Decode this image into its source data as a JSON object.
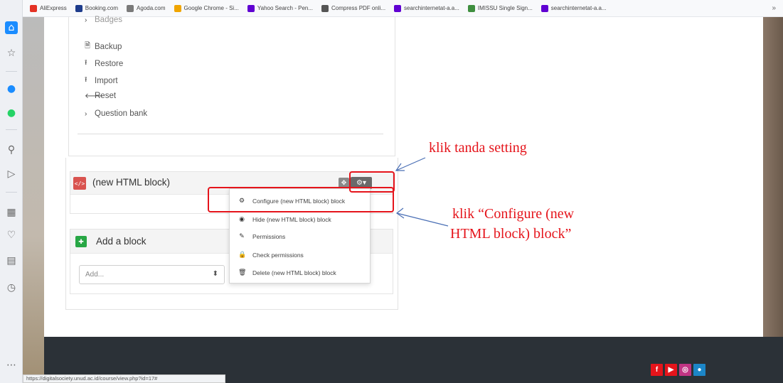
{
  "bookmarks": [
    {
      "label": "AliExpress",
      "color": "#e43225"
    },
    {
      "label": "Booking.com",
      "color": "#1e3c8c"
    },
    {
      "label": "Agoda.com",
      "color": "#7a7a7a"
    },
    {
      "label": "Google Chrome - Si...",
      "color": "#f0a500"
    },
    {
      "label": "Yahoo Search - Pen...",
      "color": "#6001d2"
    },
    {
      "label": "Compress PDF onli...",
      "color": "#555555"
    },
    {
      "label": "searchinternetat-a.a...",
      "color": "#6001d2"
    },
    {
      "label": "IMISSU Single Sign...",
      "color": "#3f8f3f"
    },
    {
      "label": "searchinternetat-a.a...",
      "color": "#6001d2"
    }
  ],
  "bookmarks_more": "»",
  "admin_menu": {
    "cut_item": "Badges",
    "items": [
      {
        "label": "Backup",
        "icon": "backup-icon",
        "glyph": "🗎"
      },
      {
        "label": "Restore",
        "icon": "upload-icon",
        "glyph": "⭱"
      },
      {
        "label": "Import",
        "icon": "upload-icon",
        "glyph": "⭱"
      },
      {
        "label": "Reset",
        "icon": "arrow-left-icon",
        "glyph": "🡐"
      },
      {
        "label": "Question bank",
        "icon": "chevron-right-icon",
        "glyph": "›"
      }
    ]
  },
  "html_block": {
    "title": "(new HTML block)",
    "icon_text": "</>",
    "move_glyph": "✥",
    "gear_glyph": "⚙▾"
  },
  "dropdown": {
    "items": [
      {
        "label": "Configure (new HTML block) block",
        "icon": "gear-icon",
        "glyph": "⚙"
      },
      {
        "label": "Hide (new HTML block) block",
        "icon": "eye-icon",
        "glyph": "◉"
      },
      {
        "label": "Permissions",
        "icon": "edit-icon",
        "glyph": "✎"
      },
      {
        "label": "Check permissions",
        "icon": "lock-icon",
        "glyph": "🔒"
      },
      {
        "label": "Delete (new HTML block) block",
        "icon": "trash-icon",
        "glyph": "🗑"
      }
    ]
  },
  "add_block": {
    "title": "Add a block",
    "select_value": "Add...",
    "select_arrow": "⬍",
    "icon_glyph": "✚"
  },
  "annotations": {
    "setting": "klik tanda setting",
    "configure_line1": "klik “Configure (new",
    "configure_line2": "HTML block) block”"
  },
  "status_url": "https://digitalsociety.unud.ac.id/course/view.php?id=17#",
  "social": [
    {
      "name": "facebook",
      "glyph": "f",
      "color": "#e5141b"
    },
    {
      "name": "youtube",
      "glyph": "▶",
      "color": "#e5141b"
    },
    {
      "name": "instagram",
      "glyph": "◎",
      "color": "#c13584"
    },
    {
      "name": "other",
      "glyph": "●",
      "color": "#1c86c8"
    }
  ],
  "colors": {
    "accent_red": "#e5141b",
    "footer": "#2b3137"
  }
}
